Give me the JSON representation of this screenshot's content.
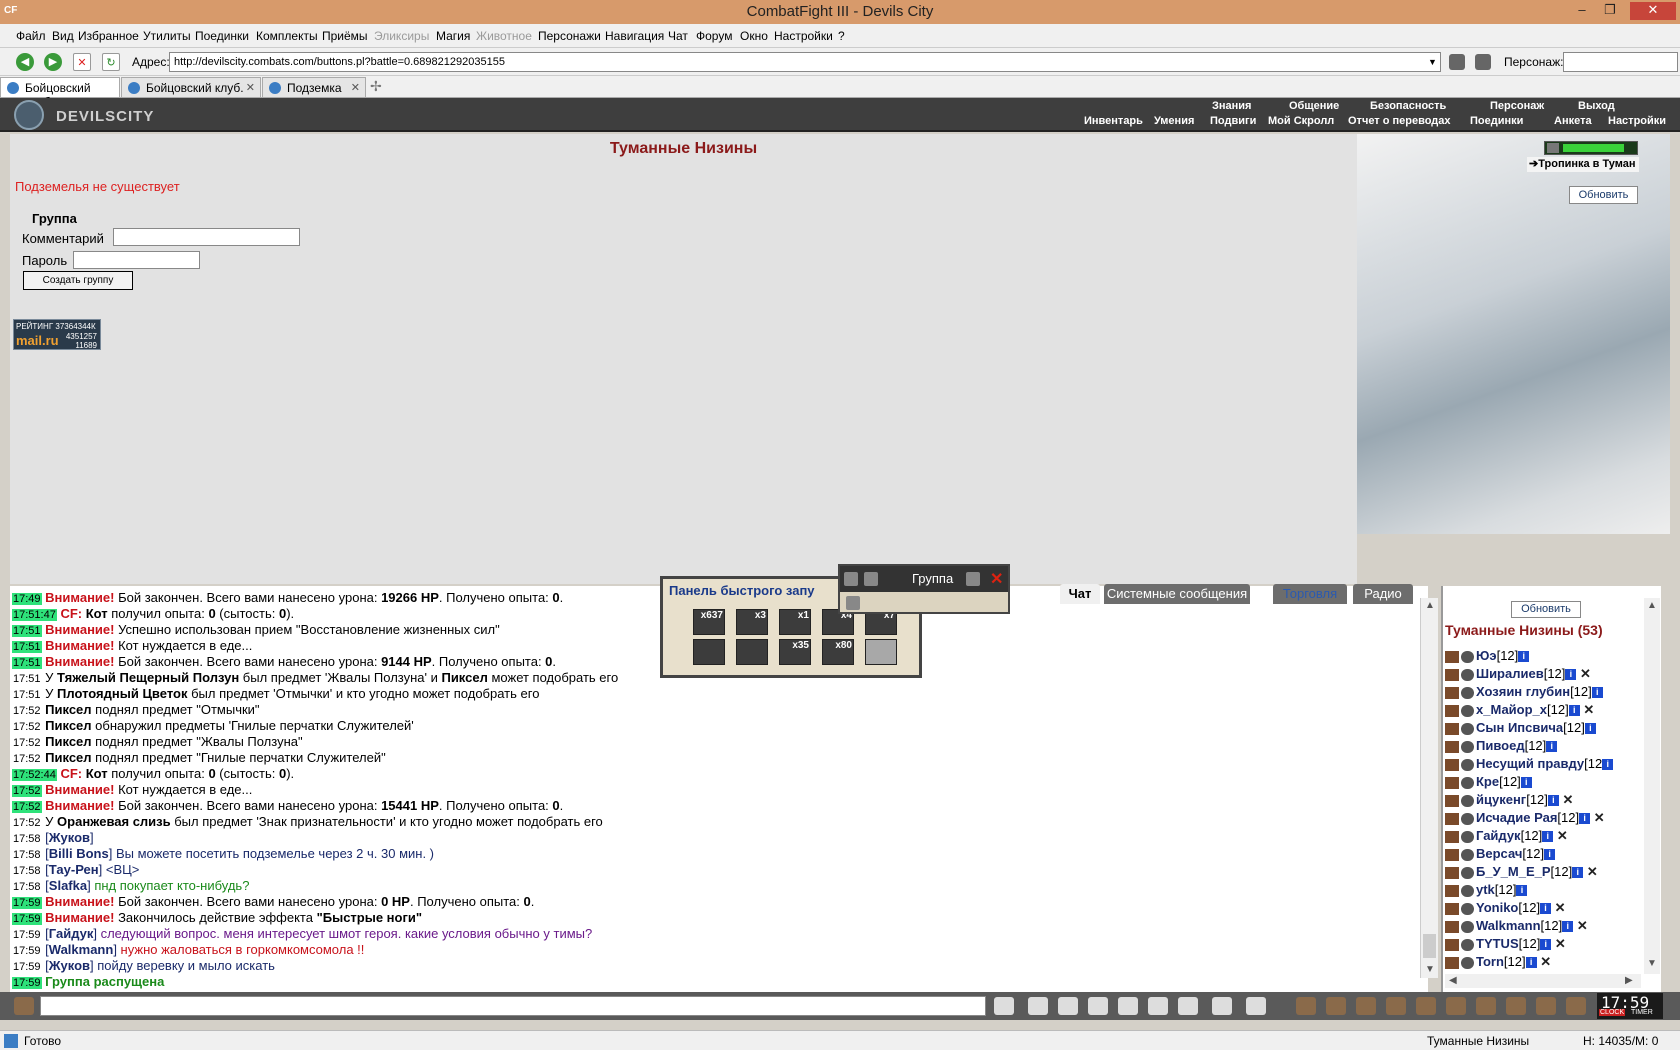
{
  "window": {
    "title": "CombatFight III - Devils City",
    "app_logo": "CF"
  },
  "menu": [
    "Файл",
    "Вид",
    "Избранное",
    "Утилиты",
    "Поединки",
    "Комплекты",
    "Приёмы",
    "Эликсиры",
    "Магия",
    "Животное",
    "Персонажи",
    "Навигация",
    "Чат",
    "Форум",
    "Окно",
    "Настройки",
    "?"
  ],
  "menu_disabled": [
    "Эликсиры",
    "Животное"
  ],
  "address": {
    "label": "Адрес:",
    "url": "http://devilscity.combats.com/buttons.pl?battle=0.689821292035155",
    "persona_label": "Персонаж:"
  },
  "tabs": [
    {
      "label": "Бойцовский клуб",
      "active": true
    },
    {
      "label": "Бойцовский клуб.",
      "active": false
    },
    {
      "label": "Подземка",
      "active": false
    }
  ],
  "game": {
    "logo": "DEVILSCITY",
    "nav_top": [
      "Знания",
      "Общение",
      "Безопасность",
      "Персонаж",
      "Выход"
    ],
    "nav_bottom": [
      "Инвентарь",
      "Умения",
      "Подвиги",
      "Мой Скролл",
      "Отчет о переводах",
      "Поединки",
      "Анкета",
      "Настройки"
    ]
  },
  "main": {
    "location_title": "Туманные Низины",
    "warning": "Подземелья не существует",
    "group_title": "Группа",
    "comment_label": "Комментарий",
    "password_label": "Пароль",
    "create_button": "Создать группу",
    "counter_top": "РЕЙТИНГ 37364344К",
    "counter_mail": "mail.ru",
    "counter_n1": "4351257",
    "counter_n2": "11689"
  },
  "side": {
    "trail": "➔Тропинка в Туман",
    "refresh": "Обновить",
    "hp_fraction": 0.85
  },
  "chat_tabs": [
    "Чат",
    "Системные сообщения",
    "Торговля",
    "Радио"
  ],
  "quick_panel": {
    "title": "Панель быстрого запу",
    "slots": [
      "x637",
      "x3",
      "x1",
      "x4",
      "x7",
      "",
      "",
      "x35",
      "x80",
      ""
    ],
    "group_title": "Группа",
    "group_close": "✕"
  },
  "chat": [
    {
      "time": "17:49",
      "hl": true,
      "parts": [
        [
          "red b",
          "Внимание!"
        ],
        [
          "",
          " Бой закончен. Всего вами нанесено урона: "
        ],
        [
          "b",
          "19266 HP"
        ],
        [
          "",
          ". Получено опыта: "
        ],
        [
          "b",
          "0"
        ],
        [
          "",
          "."
        ]
      ]
    },
    {
      "time": "17:51:47",
      "hl": true,
      "parts": [
        [
          "red b",
          "CF:"
        ],
        [
          "b",
          " Кот"
        ],
        [
          "",
          " получил опыта: "
        ],
        [
          "b",
          "0"
        ],
        [
          "",
          " (сытость: "
        ],
        [
          "b",
          "0"
        ],
        [
          "",
          ")."
        ]
      ]
    },
    {
      "time": "17:51",
      "hl": true,
      "parts": [
        [
          "red b",
          "Внимание!"
        ],
        [
          "",
          " Успешно использован прием \"Восстановление жизненных сил\""
        ]
      ]
    },
    {
      "time": "17:51",
      "hl": true,
      "parts": [
        [
          "red b",
          "Внимание!"
        ],
        [
          "",
          " Кот нуждается в еде..."
        ]
      ]
    },
    {
      "time": "17:51",
      "hl": true,
      "parts": [
        [
          "red b",
          "Внимание!"
        ],
        [
          "",
          " Бой закончен. Всего вами нанесено урона: "
        ],
        [
          "b",
          "9144 HP"
        ],
        [
          "",
          ". Получено опыта: "
        ],
        [
          "b",
          "0"
        ],
        [
          "",
          "."
        ]
      ]
    },
    {
      "time": "17:51",
      "hl": false,
      "parts": [
        [
          "",
          "У "
        ],
        [
          "b",
          "Тяжелый Пещерный Ползун"
        ],
        [
          "",
          " был предмет 'Жвалы Ползуна' и "
        ],
        [
          "b",
          "Пиксел"
        ],
        [
          "",
          " может подобрать его"
        ]
      ]
    },
    {
      "time": "17:51",
      "hl": false,
      "parts": [
        [
          "",
          "У "
        ],
        [
          "b",
          "Плотоядный Цветок"
        ],
        [
          "",
          " был предмет 'Отмычки' и кто угодно может подобрать его"
        ]
      ]
    },
    {
      "time": "17:52",
      "hl": false,
      "parts": [
        [
          "b",
          "Пиксел"
        ],
        [
          "",
          " поднял предмет \"Отмычки\""
        ]
      ]
    },
    {
      "time": "17:52",
      "hl": false,
      "parts": [
        [
          "b",
          "Пиксел"
        ],
        [
          "",
          " обнаружил предметы 'Гнилые перчатки Служителей'"
        ]
      ]
    },
    {
      "time": "17:52",
      "hl": false,
      "parts": [
        [
          "b",
          "Пиксел"
        ],
        [
          "",
          " поднял предмет \"Жвалы Ползуна\""
        ]
      ]
    },
    {
      "time": "17:52",
      "hl": false,
      "parts": [
        [
          "b",
          "Пиксел"
        ],
        [
          "",
          " поднял предмет \"Гнилые перчатки Служителей\""
        ]
      ]
    },
    {
      "time": "17:52:44",
      "hl": true,
      "parts": [
        [
          "red b",
          "CF:"
        ],
        [
          "b",
          " Кот"
        ],
        [
          "",
          " получил опыта: "
        ],
        [
          "b",
          "0"
        ],
        [
          "",
          " (сытость: "
        ],
        [
          "b",
          "0"
        ],
        [
          "",
          ")."
        ]
      ]
    },
    {
      "time": "17:52",
      "hl": true,
      "parts": [
        [
          "red b",
          "Внимание!"
        ],
        [
          "",
          " Кот нуждается в еде..."
        ]
      ]
    },
    {
      "time": "17:52",
      "hl": true,
      "parts": [
        [
          "red b",
          "Внимание!"
        ],
        [
          "",
          " Бой закончен. Всего вами нанесено урона: "
        ],
        [
          "b",
          "15441 HP"
        ],
        [
          "",
          ". Получено опыта: "
        ],
        [
          "b",
          "0"
        ],
        [
          "",
          "."
        ]
      ]
    },
    {
      "time": "17:52",
      "hl": false,
      "parts": [
        [
          "",
          "У "
        ],
        [
          "b",
          "Оранжевая слизь"
        ],
        [
          "",
          " был предмет 'Знак признательности' и кто угодно может подобрать его"
        ]
      ]
    },
    {
      "time": "17:58",
      "hl": false,
      "parts": [
        [
          "blue",
          "["
        ],
        [
          "blue b",
          "Жуков"
        ],
        [
          "blue",
          "]"
        ]
      ]
    },
    {
      "time": "17:58",
      "hl": false,
      "parts": [
        [
          "blue",
          "["
        ],
        [
          "blue b",
          "Billi Bons"
        ],
        [
          "blue",
          "] Вы можете посетить подземелье через 2 ч. 30 мин. )"
        ]
      ]
    },
    {
      "time": "17:58",
      "hl": false,
      "parts": [
        [
          "blue",
          "["
        ],
        [
          "blue b",
          "Тау-Рен"
        ],
        [
          "blue",
          "] <ВЦ>"
        ]
      ]
    },
    {
      "time": "17:58",
      "hl": false,
      "parts": [
        [
          "blue",
          "["
        ],
        [
          "blue b",
          "Slafka"
        ],
        [
          "blue",
          "] "
        ],
        [
          "green",
          "пнд покупает кто-нибудь?"
        ]
      ]
    },
    {
      "time": "17:59",
      "hl": true,
      "parts": [
        [
          "red b",
          "Внимание!"
        ],
        [
          "",
          " Бой закончен. Всего вами нанесено урона: "
        ],
        [
          "b",
          "0 HP"
        ],
        [
          "",
          ". Получено опыта: "
        ],
        [
          "b",
          "0"
        ],
        [
          "",
          "."
        ]
      ]
    },
    {
      "time": "17:59",
      "hl": true,
      "parts": [
        [
          "red b",
          "Внимание!"
        ],
        [
          "",
          " Закончилось действие эффекта "
        ],
        [
          "b",
          "\"Быстрые ноги\""
        ]
      ]
    },
    {
      "time": "17:59",
      "hl": false,
      "parts": [
        [
          "blue",
          "["
        ],
        [
          "blue b",
          "Гайдук"
        ],
        [
          "blue",
          "] "
        ],
        [
          "purple",
          "следующий вопрос. меня интересует шмот героя. какие условия обычно у тимы?"
        ]
      ]
    },
    {
      "time": "17:59",
      "hl": false,
      "parts": [
        [
          "blue",
          "["
        ],
        [
          "blue b",
          "Walkmann"
        ],
        [
          "blue",
          "] "
        ],
        [
          "red",
          "нужно жаловаться в горкомкомсомола !!"
        ]
      ]
    },
    {
      "time": "17:59",
      "hl": false,
      "parts": [
        [
          "blue",
          "["
        ],
        [
          "blue b",
          "Жуков"
        ],
        [
          "blue",
          "] пойду веревку и мыло искать"
        ]
      ]
    },
    {
      "time": "17:59",
      "hl": true,
      "parts": [
        [
          "green b",
          "Группа распущена"
        ]
      ]
    }
  ],
  "userlist": {
    "refresh": "Обновить",
    "title": "Туманные Низины (53)",
    "users": [
      {
        "name": "Юэ",
        "level": "[12]",
        "del": false
      },
      {
        "name": "Ширалиев",
        "level": "[12]",
        "del": true
      },
      {
        "name": "Хозяин глубин",
        "level": "[12]",
        "del": false
      },
      {
        "name": "х_Майор_х",
        "level": "[12]",
        "del": true
      },
      {
        "name": "Сын Ипсвича",
        "level": "[12]",
        "del": false
      },
      {
        "name": "Пивоед",
        "level": "[12]",
        "del": false
      },
      {
        "name": "Несущий правду",
        "level": "[12",
        "del": false
      },
      {
        "name": "Кре",
        "level": "[12]",
        "del": false
      },
      {
        "name": "йцукенг",
        "level": "[12]",
        "del": true
      },
      {
        "name": "Исчадие Рая",
        "level": "[12]",
        "del": true
      },
      {
        "name": "Гайдук",
        "level": "[12]",
        "del": true
      },
      {
        "name": "Версач",
        "level": "[12]",
        "del": false
      },
      {
        "name": "Б_У_М_Е_Р",
        "level": "[12]",
        "del": true
      },
      {
        "name": "ytk",
        "level": "[12]",
        "del": false
      },
      {
        "name": "Yoniko",
        "level": "[12]",
        "del": true
      },
      {
        "name": "Walkmann",
        "level": "[12]",
        "del": true
      },
      {
        "name": "TYTUS",
        "level": "[12]",
        "del": true
      },
      {
        "name": "Torn",
        "level": "[12]",
        "del": true
      }
    ]
  },
  "clock": {
    "time": "17:59",
    "clock_label": "CLOCK",
    "timer_label": "TIMER"
  },
  "status": {
    "ready": "Готово",
    "location": "Туманные Низины",
    "hp": "H: 14035/M: 0"
  }
}
